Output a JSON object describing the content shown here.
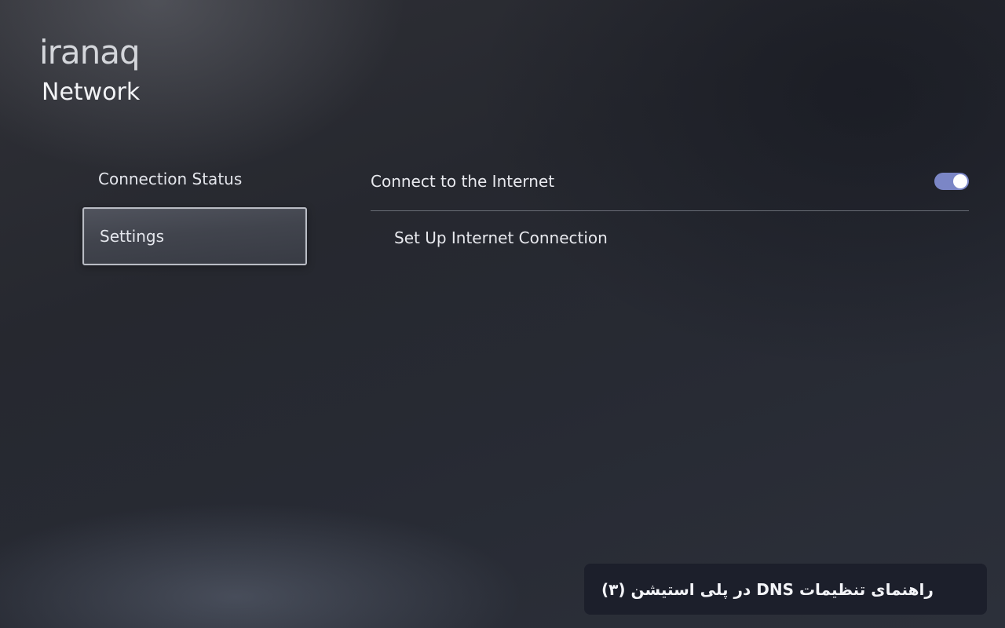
{
  "brand": {
    "logo_text": "iranaq"
  },
  "header": {
    "title": "Network"
  },
  "nav": {
    "items": [
      {
        "label": "Connection Status",
        "selected": false
      },
      {
        "label": "Settings",
        "selected": true
      }
    ]
  },
  "settings": {
    "connect_label": "Connect to the Internet",
    "connect_enabled": true,
    "setup_label": "Set Up Internet Connection"
  },
  "caption": {
    "text": "راهنمای تنظیمات DNS در پلی استیشن (۳)"
  },
  "colors": {
    "toggle_on": "#7b86c6",
    "caption_bg": "#1c1f2b"
  }
}
